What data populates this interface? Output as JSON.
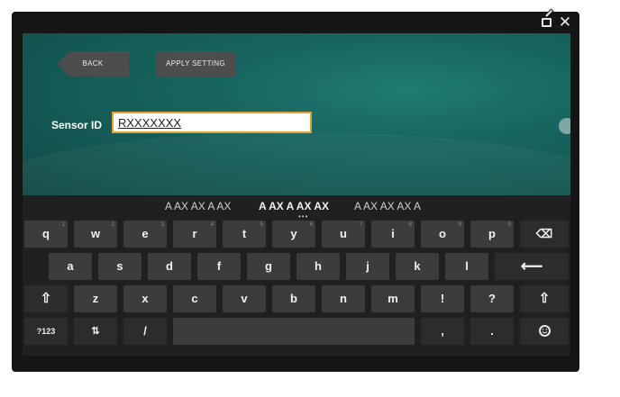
{
  "window": {
    "popout_icon": "popout-icon",
    "close_icon": "close-icon",
    "close_glyph": "✕"
  },
  "toolbar": {
    "back_label": "BACK",
    "apply_label": "APPLY SETTING"
  },
  "form": {
    "sensor_label": "Sensor ID",
    "sensor_value": "RXXXXXXX"
  },
  "keyboard": {
    "suggestions": [
      "A AX AX A AX",
      "A AX A AX AX",
      "A AX AX AX A"
    ],
    "suggestion_more": "•••",
    "row1": [
      {
        "label": "q",
        "hint": "1"
      },
      {
        "label": "w",
        "hint": "2"
      },
      {
        "label": "e",
        "hint": "3"
      },
      {
        "label": "r",
        "hint": "4"
      },
      {
        "label": "t",
        "hint": "5"
      },
      {
        "label": "y",
        "hint": "6"
      },
      {
        "label": "u",
        "hint": "7"
      },
      {
        "label": "i",
        "hint": "8"
      },
      {
        "label": "o",
        "hint": "9"
      },
      {
        "label": "p",
        "hint": "0"
      }
    ],
    "backspace_icon": "backspace-icon",
    "backspace_glyph": "⌫",
    "row2": [
      "a",
      "s",
      "d",
      "f",
      "g",
      "h",
      "j",
      "k",
      "l"
    ],
    "enter_icon": "enter-icon",
    "enter_glyph": "⟵",
    "shift_icon": "shift-icon",
    "shift_glyph": "⇧",
    "row3": [
      "z",
      "x",
      "c",
      "v",
      "b",
      "n",
      "m",
      "!",
      "?"
    ],
    "symbols_label": "?123",
    "settings_icon": "keyboard-settings-icon",
    "settings_glyph": "⇅",
    "slash_label": "/",
    "comma_label": ",",
    "period_label": ".",
    "emoji_icon": "emoji-icon",
    "colors": {
      "key": "#3c3c3c",
      "key_dark": "#2c2c2c",
      "keyboard_bg": "#202020",
      "input_border": "#e6a030",
      "screen_bg": "#18655f"
    }
  }
}
